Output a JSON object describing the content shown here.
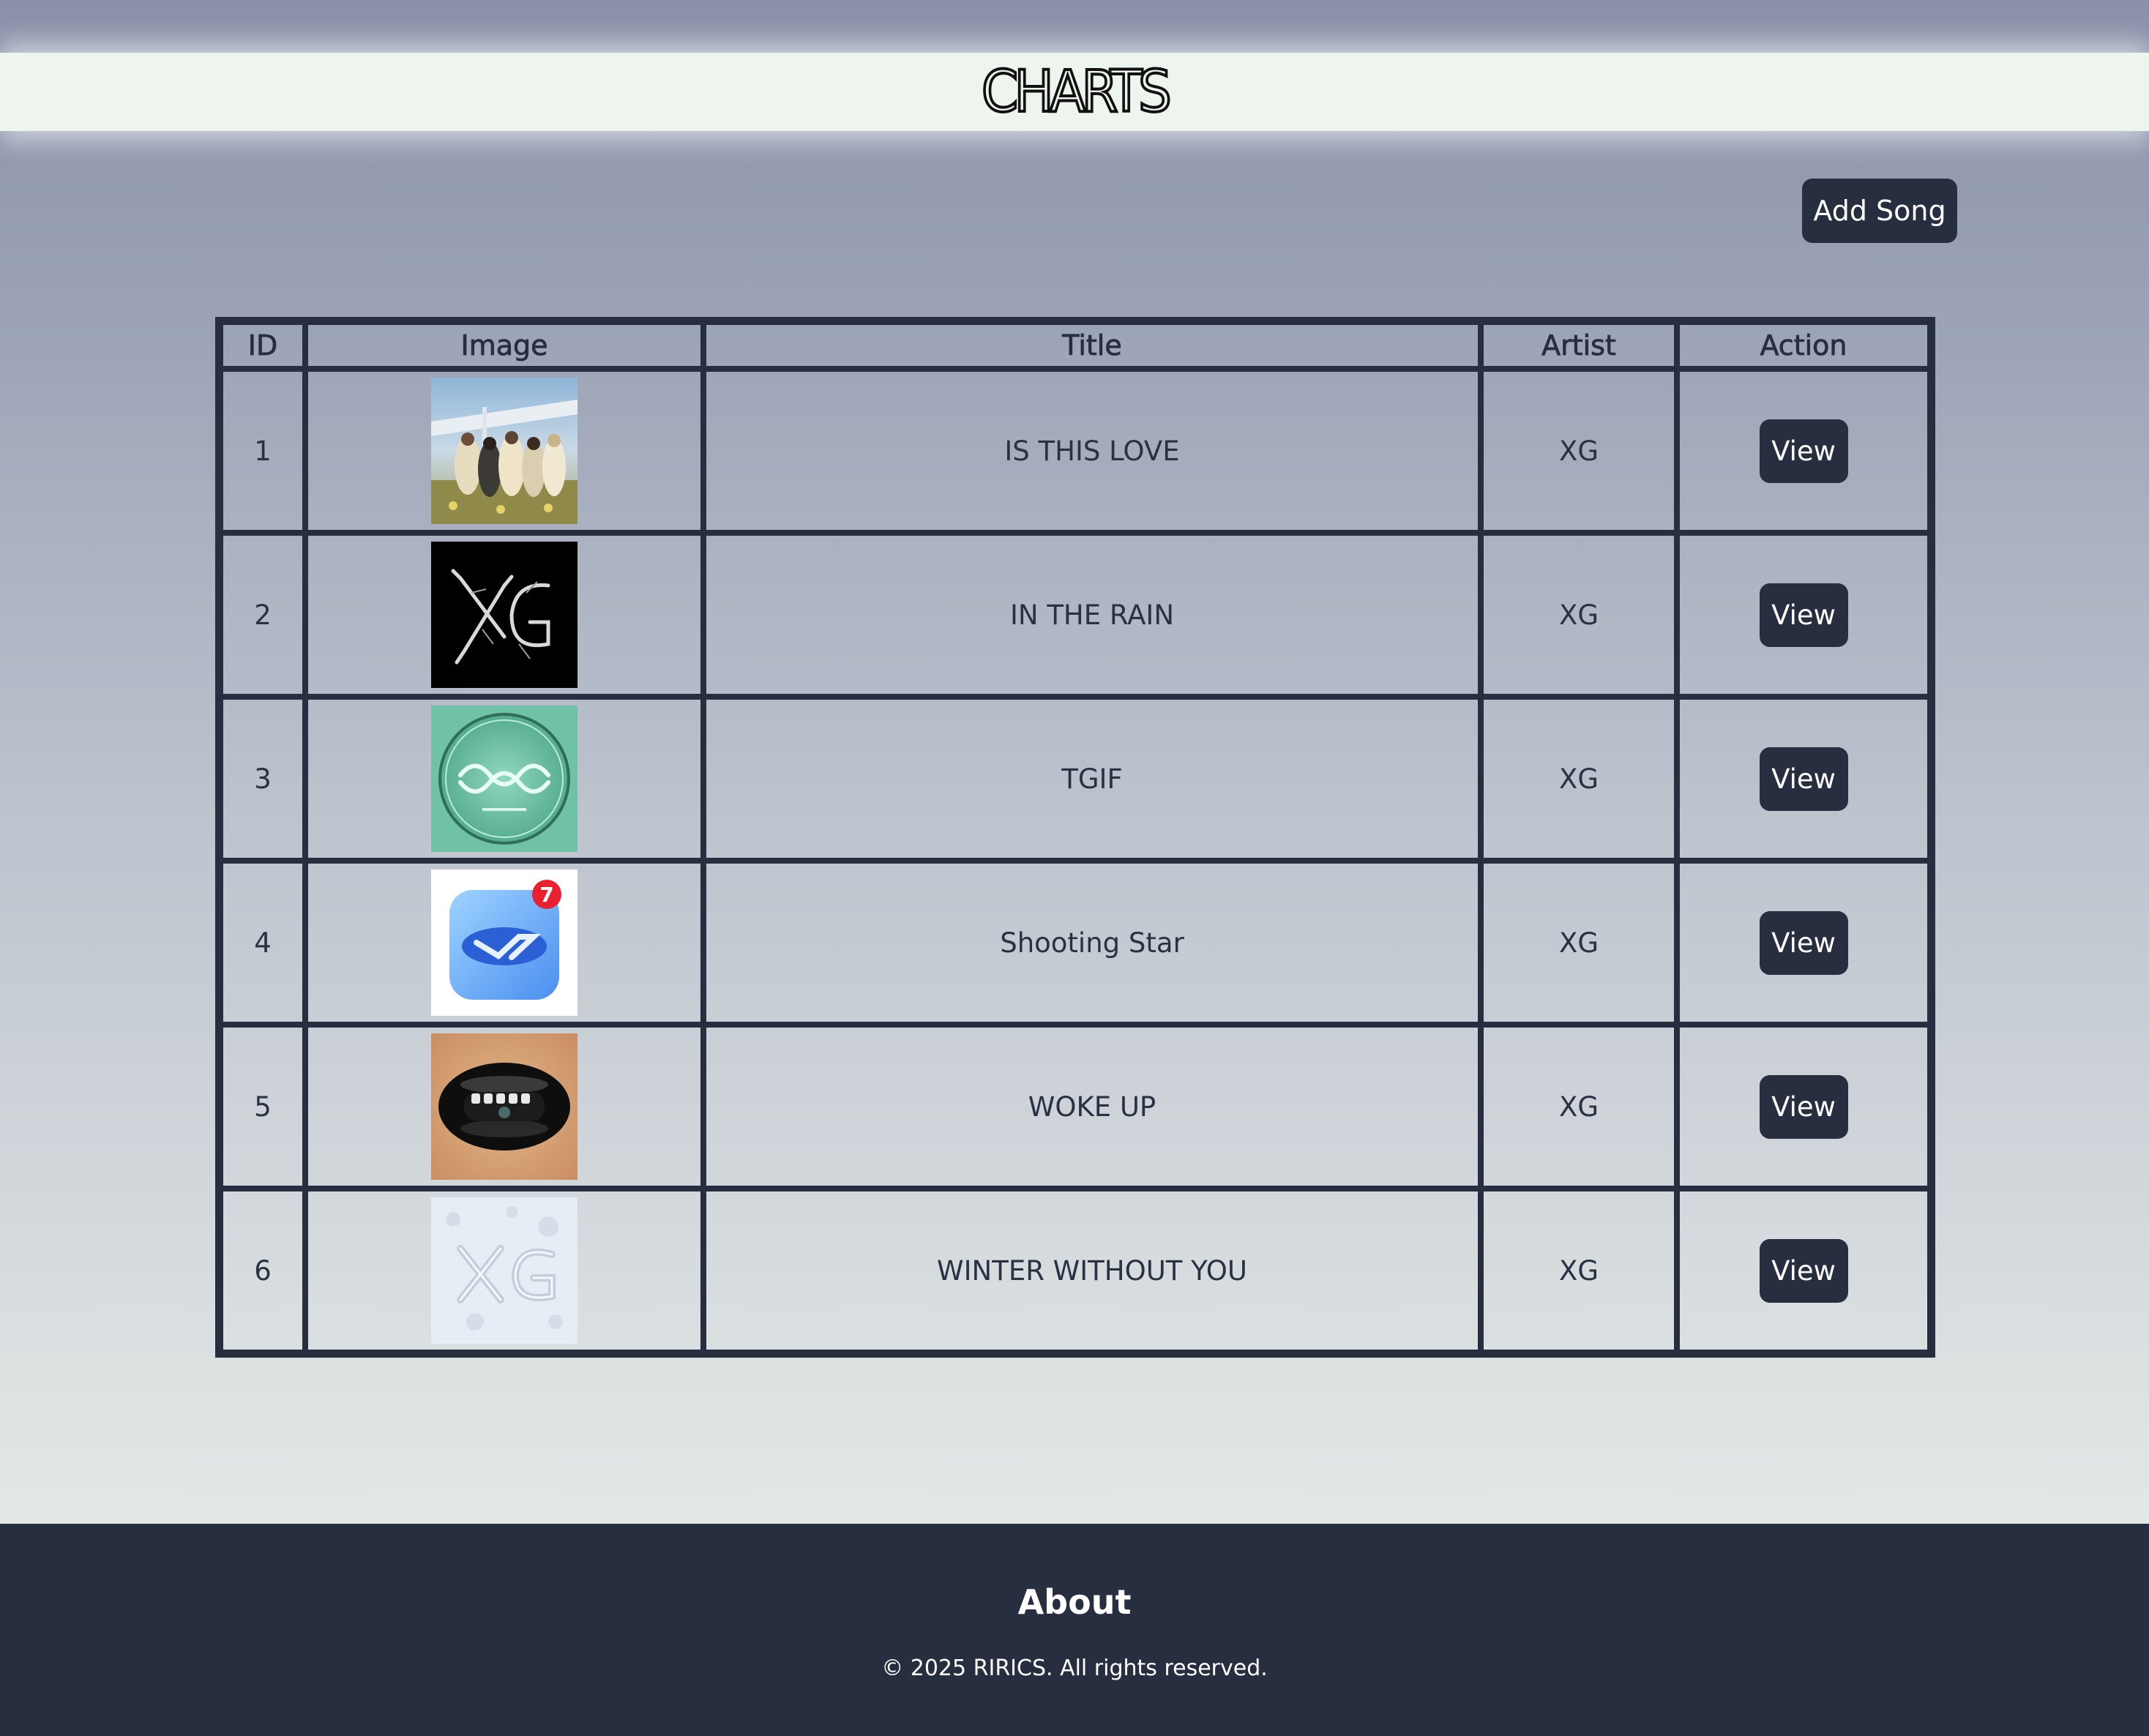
{
  "header": {
    "logo_text": "CHARTS"
  },
  "toolbar": {
    "add_song_label": "Add Song"
  },
  "table": {
    "columns": [
      "ID",
      "Image",
      "Title",
      "Artist",
      "Action"
    ],
    "rows": [
      {
        "id": "1",
        "title": "IS THIS LOVE",
        "artist": "XG",
        "action": "View",
        "cover": "group-photo-cover"
      },
      {
        "id": "2",
        "title": "IN THE RAIN",
        "artist": "XG",
        "action": "View",
        "cover": "chrome-xg-logo-cover"
      },
      {
        "id": "3",
        "title": "TGIF",
        "artist": "XG",
        "action": "View",
        "cover": "green-emblem-cover"
      },
      {
        "id": "4",
        "title": "Shooting Star",
        "artist": "XG",
        "action": "View",
        "cover": "app-icon-cover",
        "cover_badge": "7"
      },
      {
        "id": "5",
        "title": "WOKE UP",
        "artist": "XG",
        "action": "View",
        "cover": "black-lips-cover"
      },
      {
        "id": "6",
        "title": "WINTER WITHOUT YOU",
        "artist": "XG",
        "action": "View",
        "cover": "snow-xg-cover"
      }
    ]
  },
  "footer": {
    "heading": "About",
    "copyright": "© 2025 RIRICS. All rights reserved."
  },
  "colors": {
    "primary_dark": "#262e40",
    "header_bg": "#eef4ee",
    "badge_red": "#e8202f"
  }
}
